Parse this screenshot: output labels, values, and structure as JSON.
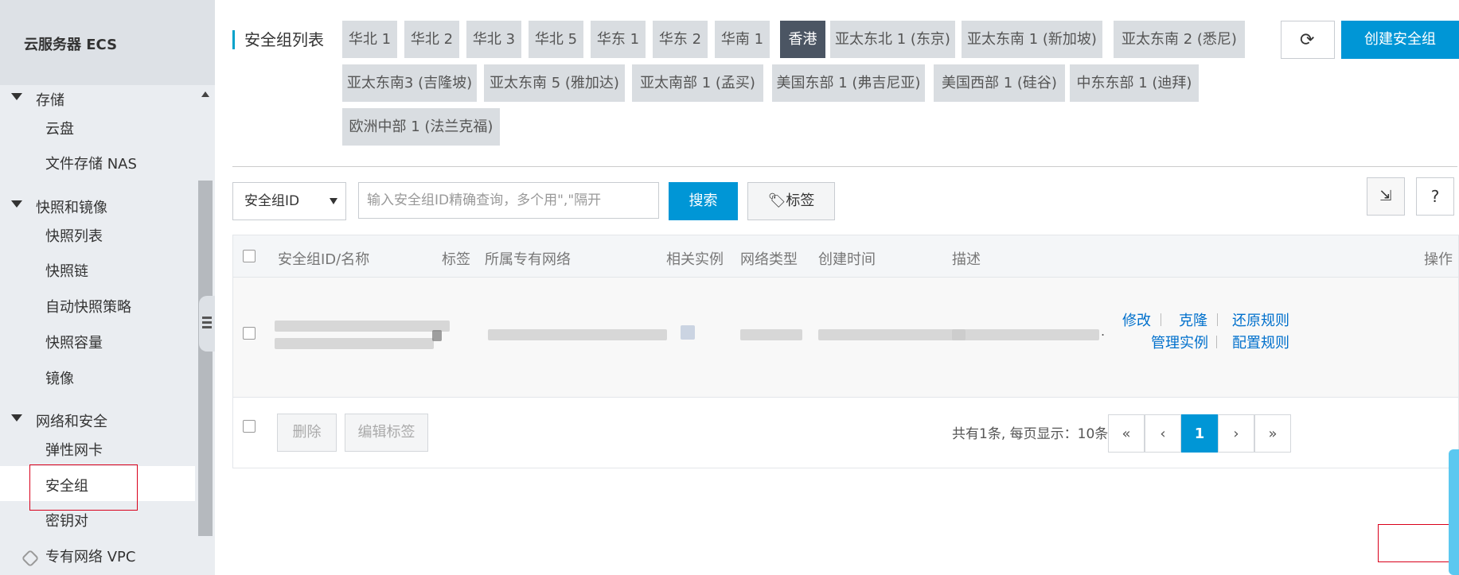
{
  "sidebar": {
    "title": "云服务器 ECS",
    "groups": [
      {
        "label": "存储",
        "items": [
          "云盘",
          "文件存储 NAS"
        ]
      },
      {
        "label": "快照和镜像",
        "items": [
          "快照列表",
          "快照链",
          "自动快照策略",
          "快照容量",
          "镜像"
        ]
      },
      {
        "label": "网络和安全",
        "items": [
          "弹性网卡",
          "安全组",
          "密钥对"
        ]
      }
    ],
    "active_item": "安全组",
    "vpc_link": "专有网络 VPC"
  },
  "header": {
    "title": "安全组列表",
    "regions": [
      "华北 1",
      "华北 2",
      "华北 3",
      "华北 5",
      "华东 1",
      "华东 2",
      "华南 1",
      "香港",
      "亚太东北 1 (东京)",
      "亚太东南 1 (新加坡)",
      "亚太东南 2 (悉尼)",
      "亚太东南3 (吉隆坡)",
      "亚太东南 5 (雅加达)",
      "亚太南部 1 (孟买)",
      "美国东部 1 (弗吉尼亚)",
      "美国西部 1 (硅谷)",
      "中东东部 1 (迪拜)",
      "欧洲中部 1 (法兰克福)"
    ],
    "active_region": "香港",
    "refresh_icon": "refresh-icon",
    "create_label": "创建安全组"
  },
  "search": {
    "select_value": "安全组ID",
    "placeholder": "输入安全组ID精确查询，多个用\",\"隔开",
    "search_label": "搜索",
    "tag_label": "标签",
    "export_icon": "export-icon",
    "help_label": "?"
  },
  "table": {
    "columns": [
      "安全组ID/名称",
      "标签",
      "所属专有网络",
      "相关实例",
      "网络类型",
      "创建时间",
      "描述",
      "操作"
    ],
    "row_desc_suffix": ".",
    "row_actions": [
      "修改",
      "克隆",
      "还原规则",
      "管理实例",
      "配置规则"
    ]
  },
  "footer": {
    "delete_label": "删除",
    "edit_tags_label": "编辑标签",
    "total_text": "共有1条, 每页显示：10条",
    "pager": [
      "«",
      "‹",
      "1",
      "›",
      "»"
    ],
    "current_page": "1"
  },
  "colors": {
    "accent": "#0096d6",
    "active_region": "#4b5563",
    "highlight_box": "#d9001b"
  }
}
